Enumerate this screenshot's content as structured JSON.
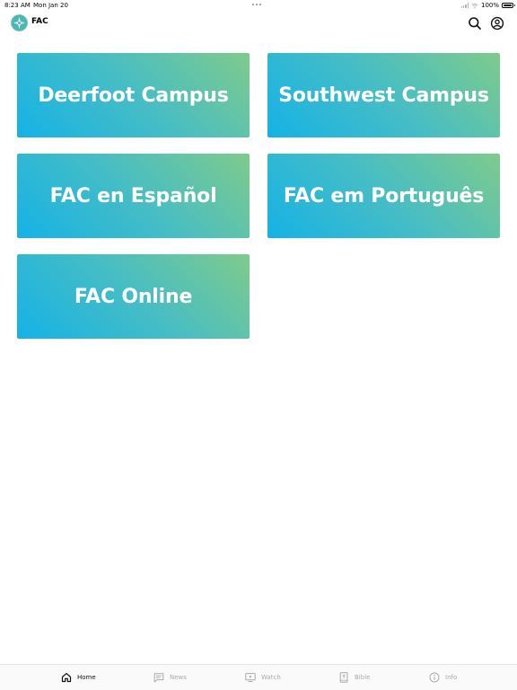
{
  "status_bar": {
    "time": "8:23 AM",
    "date": "Mon Jan 20",
    "battery": "100%"
  },
  "header": {
    "title": "FAC",
    "logo_icon": "compass-star-icon",
    "search_icon": "search-icon",
    "account_icon": "account-circle-icon"
  },
  "tiles": [
    {
      "label": "Deerfoot Campus"
    },
    {
      "label": "Southwest Campus"
    },
    {
      "label": "FAC en Español"
    },
    {
      "label": "FAC em Português"
    },
    {
      "label": "FAC Online"
    }
  ],
  "colors": {
    "tile_gradient_start": "#15b2e6",
    "tile_gradient_end": "#7fcb8b",
    "logo_teal": "#4ab8b5"
  },
  "tab_bar": {
    "tabs": [
      {
        "label": "Home",
        "icon": "home-icon",
        "active": true
      },
      {
        "label": "News",
        "icon": "news-icon",
        "active": false
      },
      {
        "label": "Watch",
        "icon": "watch-icon",
        "active": false
      },
      {
        "label": "Bible",
        "icon": "bible-icon",
        "active": false
      },
      {
        "label": "Info",
        "icon": "info-icon",
        "active": false
      }
    ]
  }
}
